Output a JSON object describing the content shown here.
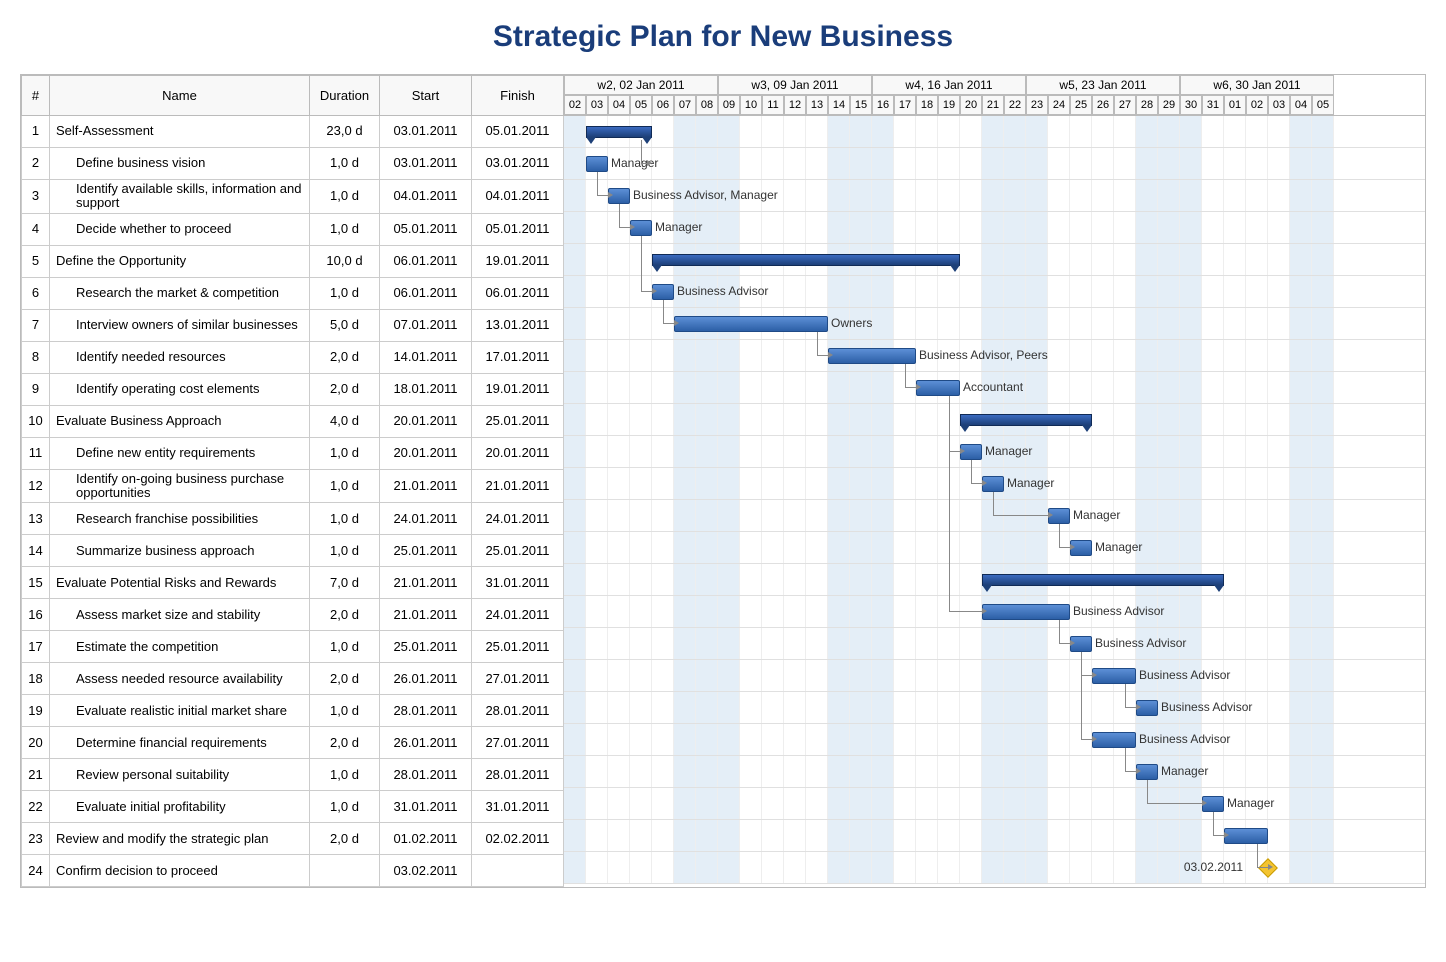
{
  "title": "Strategic Plan for New Business",
  "columns": {
    "num": "#",
    "name": "Name",
    "duration": "Duration",
    "start": "Start",
    "finish": "Finish"
  },
  "weeks": [
    {
      "label": "w2, 02 Jan 2011",
      "span": 7
    },
    {
      "label": "w3, 09 Jan 2011",
      "span": 7
    },
    {
      "label": "w4, 16 Jan 2011",
      "span": 7
    },
    {
      "label": "w5, 23 Jan 2011",
      "span": 7
    },
    {
      "label": "w6, 30 Jan 2011",
      "span": 7
    }
  ],
  "days": [
    "02",
    "03",
    "04",
    "05",
    "06",
    "07",
    "08",
    "09",
    "10",
    "11",
    "12",
    "13",
    "14",
    "15",
    "16",
    "17",
    "18",
    "19",
    "20",
    "21",
    "22",
    "23",
    "24",
    "25",
    "26",
    "27",
    "28",
    "29",
    "30",
    "31",
    "01",
    "02",
    "03",
    "04",
    "05"
  ],
  "weekendCols": [
    0,
    5,
    6,
    7,
    12,
    13,
    14,
    19,
    20,
    21,
    26,
    27,
    28,
    33,
    34
  ],
  "tasks": [
    {
      "n": 1,
      "name": "Self-Assessment",
      "dur": "23,0 d",
      "start": "03.01.2011",
      "finish": "05.01.2011",
      "indent": 0,
      "type": "summary",
      "bar": {
        "s": 1,
        "e": 4
      },
      "label": ""
    },
    {
      "n": 2,
      "name": "Define business vision",
      "dur": "1,0 d",
      "start": "03.01.2011",
      "finish": "03.01.2011",
      "indent": 1,
      "type": "bar",
      "bar": {
        "s": 1,
        "e": 2
      },
      "label": "Manager",
      "depFrom": 1
    },
    {
      "n": 3,
      "name": "Identify available skills, information and support",
      "dur": "1,0 d",
      "start": "04.01.2011",
      "finish": "04.01.2011",
      "indent": 1,
      "type": "bar",
      "bar": {
        "s": 2,
        "e": 3
      },
      "label": "Business Advisor, Manager",
      "depFrom": 2
    },
    {
      "n": 4,
      "name": "Decide whether to proceed",
      "dur": "1,0 d",
      "start": "05.01.2011",
      "finish": "05.01.2011",
      "indent": 1,
      "type": "bar",
      "bar": {
        "s": 3,
        "e": 4
      },
      "label": "Manager",
      "depFrom": 3
    },
    {
      "n": 5,
      "name": "Define the Opportunity",
      "dur": "10,0 d",
      "start": "06.01.2011",
      "finish": "19.01.2011",
      "indent": 0,
      "type": "summary",
      "bar": {
        "s": 4,
        "e": 18
      },
      "label": ""
    },
    {
      "n": 6,
      "name": "Research the market & competition",
      "dur": "1,0 d",
      "start": "06.01.2011",
      "finish": "06.01.2011",
      "indent": 1,
      "type": "bar",
      "bar": {
        "s": 4,
        "e": 5
      },
      "label": "Business Advisor",
      "depFrom": 4
    },
    {
      "n": 7,
      "name": "Interview owners of similar businesses",
      "dur": "5,0 d",
      "start": "07.01.2011",
      "finish": "13.01.2011",
      "indent": 1,
      "type": "bar",
      "bar": {
        "s": 5,
        "e": 12
      },
      "label": "Owners",
      "depFrom": 6
    },
    {
      "n": 8,
      "name": "Identify needed resources",
      "dur": "2,0 d",
      "start": "14.01.2011",
      "finish": "17.01.2011",
      "indent": 1,
      "type": "bar",
      "bar": {
        "s": 12,
        "e": 16
      },
      "label": "Business Advisor, Peers",
      "depFrom": 7
    },
    {
      "n": 9,
      "name": "Identify operating cost elements",
      "dur": "2,0 d",
      "start": "18.01.2011",
      "finish": "19.01.2011",
      "indent": 1,
      "type": "bar",
      "bar": {
        "s": 16,
        "e": 18
      },
      "label": "Accountant",
      "depFrom": 8
    },
    {
      "n": 10,
      "name": "Evaluate Business Approach",
      "dur": "4,0 d",
      "start": "20.01.2011",
      "finish": "25.01.2011",
      "indent": 0,
      "type": "summary",
      "bar": {
        "s": 18,
        "e": 24
      },
      "label": ""
    },
    {
      "n": 11,
      "name": "Define new entity requirements",
      "dur": "1,0 d",
      "start": "20.01.2011",
      "finish": "20.01.2011",
      "indent": 1,
      "type": "bar",
      "bar": {
        "s": 18,
        "e": 19
      },
      "label": "Manager",
      "depFrom": 9
    },
    {
      "n": 12,
      "name": "Identify on-going business purchase opportunities",
      "dur": "1,0 d",
      "start": "21.01.2011",
      "finish": "21.01.2011",
      "indent": 1,
      "type": "bar",
      "bar": {
        "s": 19,
        "e": 20
      },
      "label": "Manager",
      "depFrom": 11
    },
    {
      "n": 13,
      "name": "Research franchise possibilities",
      "dur": "1,0 d",
      "start": "24.01.2011",
      "finish": "24.01.2011",
      "indent": 1,
      "type": "bar",
      "bar": {
        "s": 22,
        "e": 23
      },
      "label": "Manager",
      "depFrom": 12
    },
    {
      "n": 14,
      "name": "Summarize business approach",
      "dur": "1,0 d",
      "start": "25.01.2011",
      "finish": "25.01.2011",
      "indent": 1,
      "type": "bar",
      "bar": {
        "s": 23,
        "e": 24
      },
      "label": "Manager",
      "depFrom": 13
    },
    {
      "n": 15,
      "name": "Evaluate Potential Risks and Rewards",
      "dur": "7,0 d",
      "start": "21.01.2011",
      "finish": "31.01.2011",
      "indent": 0,
      "type": "summary",
      "bar": {
        "s": 19,
        "e": 30
      },
      "label": ""
    },
    {
      "n": 16,
      "name": "Assess market size and stability",
      "dur": "2,0 d",
      "start": "21.01.2011",
      "finish": "24.01.2011",
      "indent": 1,
      "type": "bar",
      "bar": {
        "s": 19,
        "e": 23
      },
      "label": "Business Advisor",
      "depFrom": 9
    },
    {
      "n": 17,
      "name": "Estimate the competition",
      "dur": "1,0 d",
      "start": "25.01.2011",
      "finish": "25.01.2011",
      "indent": 1,
      "type": "bar",
      "bar": {
        "s": 23,
        "e": 24
      },
      "label": "Business Advisor",
      "depFrom": 16
    },
    {
      "n": 18,
      "name": "Assess needed resource availability",
      "dur": "2,0 d",
      "start": "26.01.2011",
      "finish": "27.01.2011",
      "indent": 1,
      "type": "bar",
      "bar": {
        "s": 24,
        "e": 26
      },
      "label": "Business Advisor",
      "depFrom": 17
    },
    {
      "n": 19,
      "name": "Evaluate realistic initial market share",
      "dur": "1,0 d",
      "start": "28.01.2011",
      "finish": "28.01.2011",
      "indent": 1,
      "type": "bar",
      "bar": {
        "s": 26,
        "e": 27
      },
      "label": "Business Advisor",
      "depFrom": 18
    },
    {
      "n": 20,
      "name": "Determine financial requirements",
      "dur": "2,0 d",
      "start": "26.01.2011",
      "finish": "27.01.2011",
      "indent": 1,
      "type": "bar",
      "bar": {
        "s": 24,
        "e": 26
      },
      "label": "Business Advisor",
      "depFrom": 17
    },
    {
      "n": 21,
      "name": "Review personal suitability",
      "dur": "1,0 d",
      "start": "28.01.2011",
      "finish": "28.01.2011",
      "indent": 1,
      "type": "bar",
      "bar": {
        "s": 26,
        "e": 27
      },
      "label": "Manager",
      "depFrom": 20
    },
    {
      "n": 22,
      "name": "Evaluate initial profitability",
      "dur": "1,0 d",
      "start": "31.01.2011",
      "finish": "31.01.2011",
      "indent": 1,
      "type": "bar",
      "bar": {
        "s": 29,
        "e": 30
      },
      "label": "Manager",
      "depFrom": 21
    },
    {
      "n": 23,
      "name": "Review and modify the strategic plan",
      "dur": "2,0 d",
      "start": "01.02.2011",
      "finish": "02.02.2011",
      "indent": 0,
      "type": "bar",
      "bar": {
        "s": 30,
        "e": 32
      },
      "label": "",
      "depFrom": 22
    },
    {
      "n": 24,
      "name": "Confirm decision to proceed",
      "dur": "",
      "start": "03.02.2011",
      "finish": "",
      "indent": 0,
      "type": "milestone",
      "bar": {
        "s": 32,
        "e": 32
      },
      "label": "03.02.2011",
      "depFrom": 23
    }
  ],
  "chart_data": {
    "type": "gantt",
    "title": "Strategic Plan for New Business",
    "xunit": "day",
    "xstart": "2011-01-02",
    "xend": "2011-02-05",
    "tasks": [
      {
        "id": 1,
        "name": "Self-Assessment",
        "duration_days": 23,
        "start": "2011-01-03",
        "finish": "2011-01-05",
        "summary": true
      },
      {
        "id": 2,
        "name": "Define business vision",
        "duration_days": 1,
        "start": "2011-01-03",
        "finish": "2011-01-03",
        "resource": "Manager",
        "parent": 1,
        "predecessor": 1
      },
      {
        "id": 3,
        "name": "Identify available skills, information and support",
        "duration_days": 1,
        "start": "2011-01-04",
        "finish": "2011-01-04",
        "resource": "Business Advisor, Manager",
        "parent": 1,
        "predecessor": 2
      },
      {
        "id": 4,
        "name": "Decide whether to proceed",
        "duration_days": 1,
        "start": "2011-01-05",
        "finish": "2011-01-05",
        "resource": "Manager",
        "parent": 1,
        "predecessor": 3
      },
      {
        "id": 5,
        "name": "Define the Opportunity",
        "duration_days": 10,
        "start": "2011-01-06",
        "finish": "2011-01-19",
        "summary": true
      },
      {
        "id": 6,
        "name": "Research the market & competition",
        "duration_days": 1,
        "start": "2011-01-06",
        "finish": "2011-01-06",
        "resource": "Business Advisor",
        "parent": 5,
        "predecessor": 4
      },
      {
        "id": 7,
        "name": "Interview owners of similar businesses",
        "duration_days": 5,
        "start": "2011-01-07",
        "finish": "2011-01-13",
        "resource": "Owners",
        "parent": 5,
        "predecessor": 6
      },
      {
        "id": 8,
        "name": "Identify needed resources",
        "duration_days": 2,
        "start": "2011-01-14",
        "finish": "2011-01-17",
        "resource": "Business Advisor, Peers",
        "parent": 5,
        "predecessor": 7
      },
      {
        "id": 9,
        "name": "Identify operating cost elements",
        "duration_days": 2,
        "start": "2011-01-18",
        "finish": "2011-01-19",
        "resource": "Accountant",
        "parent": 5,
        "predecessor": 8
      },
      {
        "id": 10,
        "name": "Evaluate Business Approach",
        "duration_days": 4,
        "start": "2011-01-20",
        "finish": "2011-01-25",
        "summary": true
      },
      {
        "id": 11,
        "name": "Define new entity requirements",
        "duration_days": 1,
        "start": "2011-01-20",
        "finish": "2011-01-20",
        "resource": "Manager",
        "parent": 10,
        "predecessor": 9
      },
      {
        "id": 12,
        "name": "Identify on-going business purchase opportunities",
        "duration_days": 1,
        "start": "2011-01-21",
        "finish": "2011-01-21",
        "resource": "Manager",
        "parent": 10,
        "predecessor": 11
      },
      {
        "id": 13,
        "name": "Research franchise possibilities",
        "duration_days": 1,
        "start": "2011-01-24",
        "finish": "2011-01-24",
        "resource": "Manager",
        "parent": 10,
        "predecessor": 12
      },
      {
        "id": 14,
        "name": "Summarize business approach",
        "duration_days": 1,
        "start": "2011-01-25",
        "finish": "2011-01-25",
        "resource": "Manager",
        "parent": 10,
        "predecessor": 13
      },
      {
        "id": 15,
        "name": "Evaluate Potential Risks and Rewards",
        "duration_days": 7,
        "start": "2011-01-21",
        "finish": "2011-01-31",
        "summary": true
      },
      {
        "id": 16,
        "name": "Assess market size and stability",
        "duration_days": 2,
        "start": "2011-01-21",
        "finish": "2011-01-24",
        "resource": "Business Advisor",
        "parent": 15,
        "predecessor": 9
      },
      {
        "id": 17,
        "name": "Estimate the competition",
        "duration_days": 1,
        "start": "2011-01-25",
        "finish": "2011-01-25",
        "resource": "Business Advisor",
        "parent": 15,
        "predecessor": 16
      },
      {
        "id": 18,
        "name": "Assess needed resource availability",
        "duration_days": 2,
        "start": "2011-01-26",
        "finish": "2011-01-27",
        "resource": "Business Advisor",
        "parent": 15,
        "predecessor": 17
      },
      {
        "id": 19,
        "name": "Evaluate realistic initial market share",
        "duration_days": 1,
        "start": "2011-01-28",
        "finish": "2011-01-28",
        "resource": "Business Advisor",
        "parent": 15,
        "predecessor": 18
      },
      {
        "id": 20,
        "name": "Determine financial requirements",
        "duration_days": 2,
        "start": "2011-01-26",
        "finish": "2011-01-27",
        "resource": "Business Advisor",
        "parent": 15,
        "predecessor": 17
      },
      {
        "id": 21,
        "name": "Review personal suitability",
        "duration_days": 1,
        "start": "2011-01-28",
        "finish": "2011-01-28",
        "resource": "Manager",
        "parent": 15,
        "predecessor": 20
      },
      {
        "id": 22,
        "name": "Evaluate initial profitability",
        "duration_days": 1,
        "start": "2011-01-31",
        "finish": "2011-01-31",
        "resource": "Manager",
        "parent": 15,
        "predecessor": 21
      },
      {
        "id": 23,
        "name": "Review and modify the strategic plan",
        "duration_days": 2,
        "start": "2011-02-01",
        "finish": "2011-02-02",
        "predecessor": 22
      },
      {
        "id": 24,
        "name": "Confirm decision to proceed",
        "duration_days": 0,
        "start": "2011-02-03",
        "finish": "2011-02-03",
        "milestone": true,
        "predecessor": 23
      }
    ]
  }
}
